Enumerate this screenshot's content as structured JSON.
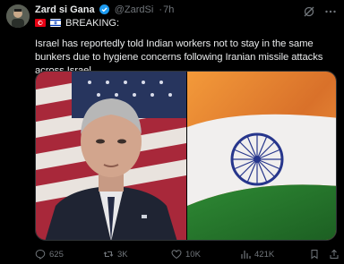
{
  "author": {
    "name": "Zard si Gana",
    "handle": "@ZardSi",
    "time": "7h",
    "avatar_icon": "avatar-image"
  },
  "badge": {
    "label": "BREAKING:",
    "flags": [
      "tunisia-flag",
      "israel-flag"
    ]
  },
  "post_text": "Israel has reportedly told Indian workers not to stay in the same bunkers due to hygiene concerns following Iranian missile attacks across Israel.",
  "media": {
    "left_image": "netanyahu-with-us-flag",
    "right_image": "india-flag"
  },
  "actions": {
    "replies": "625",
    "reposts": "3K",
    "likes": "10K",
    "views": "421K"
  },
  "colors": {
    "background": "#000000",
    "text": "#e7e9ea",
    "muted": "#71767b",
    "verified": "#1d9bf0"
  }
}
